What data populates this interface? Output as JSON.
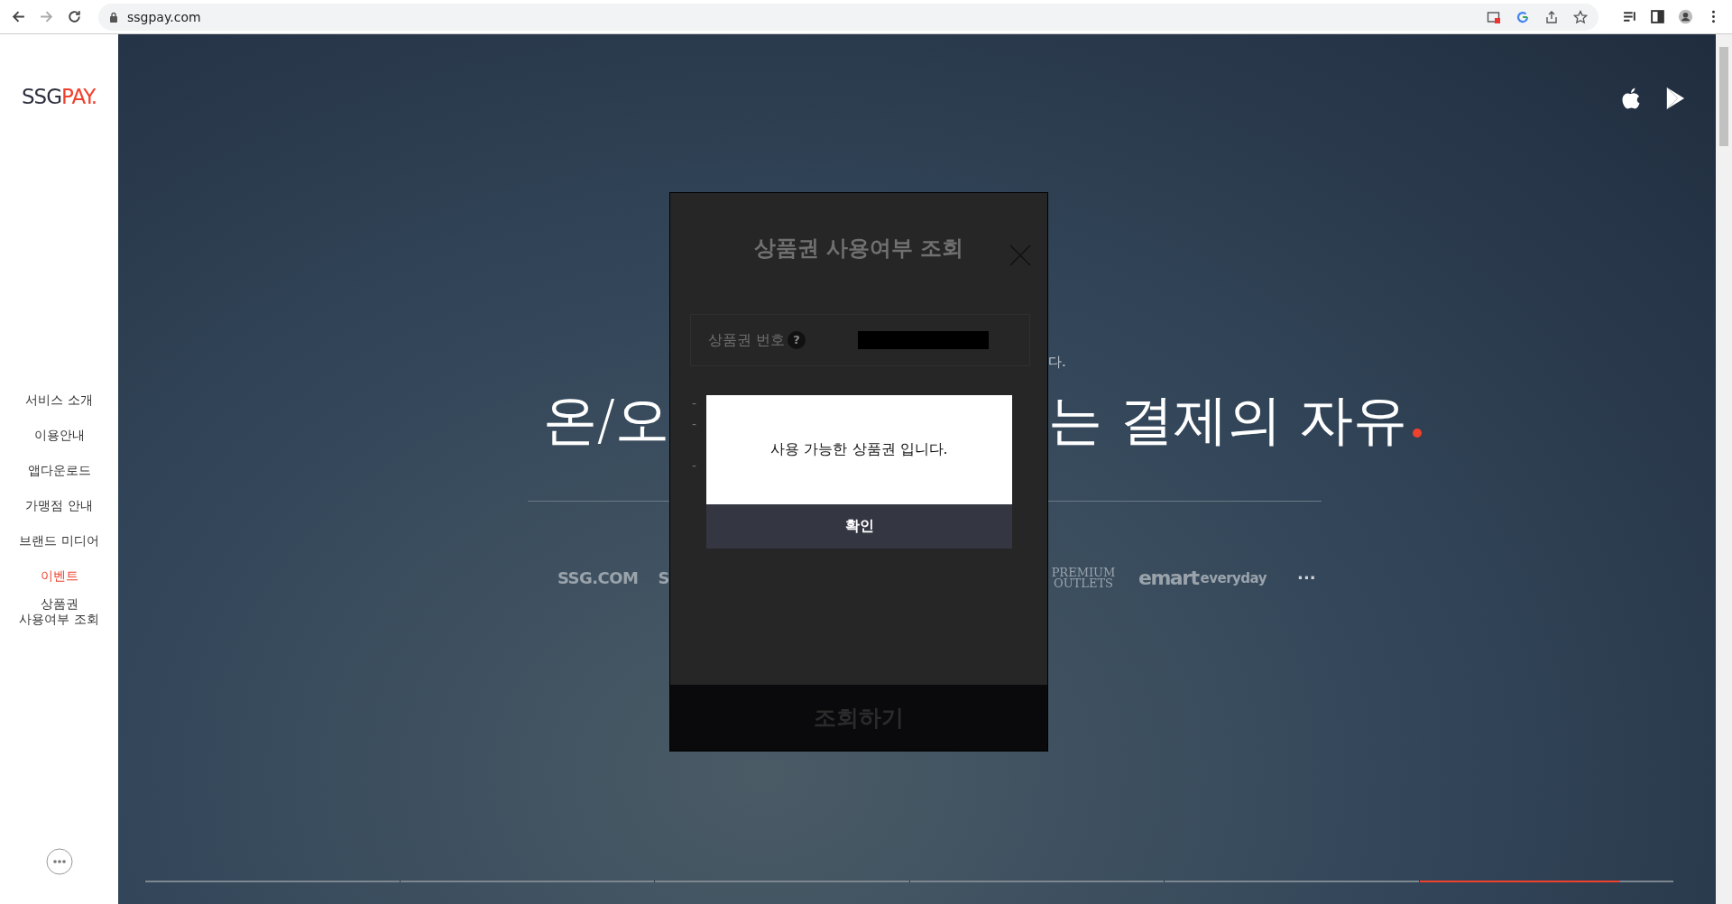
{
  "browser": {
    "url": "ssgpay.com",
    "forward_disabled": true
  },
  "sidebar": {
    "logo": {
      "dark": "SSG",
      "accent": "PAY."
    },
    "items": [
      {
        "label": "서비스 소개",
        "selected": false
      },
      {
        "label": "이용안내",
        "selected": false
      },
      {
        "label": "앱다운로드",
        "selected": false
      },
      {
        "label": "가맹점 안내",
        "selected": false
      },
      {
        "label": "브랜드 미디어",
        "selected": false
      },
      {
        "label": "이벤트",
        "selected": true
      },
      {
        "label": "상품권 사용여부 조회",
        "selected": false
      }
    ]
  },
  "hero": {
    "tagline_fragment": "다.",
    "headline_left": "온/오",
    "headline_right": "는 결제의 자유",
    "brands_left": [
      "SSG.COM",
      "S"
    ],
    "brands_right": [
      {
        "kind": "serif",
        "label": "PREMIUM OUTLETS"
      },
      {
        "kind": "heavy",
        "label": "emart"
      },
      {
        "kind": "light",
        "label": "everyday"
      },
      {
        "kind": "dots",
        "label": "···"
      }
    ]
  },
  "slides": [
    {
      "selected": false
    },
    {
      "selected": false
    },
    {
      "selected": false
    },
    {
      "selected": false
    },
    {
      "selected": false
    },
    {
      "selected": true
    }
  ],
  "slide_progress": {
    "level": 0.79
  },
  "modal": {
    "title": "상품권 사용여부 조회",
    "field_label": "상품권 번호",
    "help": "?",
    "notes": [
      "-",
      "-",
      "-"
    ],
    "submit": "조회하기"
  },
  "alert": {
    "message": "사용 가능한 상품권 입니다.",
    "confirm": "확인"
  }
}
